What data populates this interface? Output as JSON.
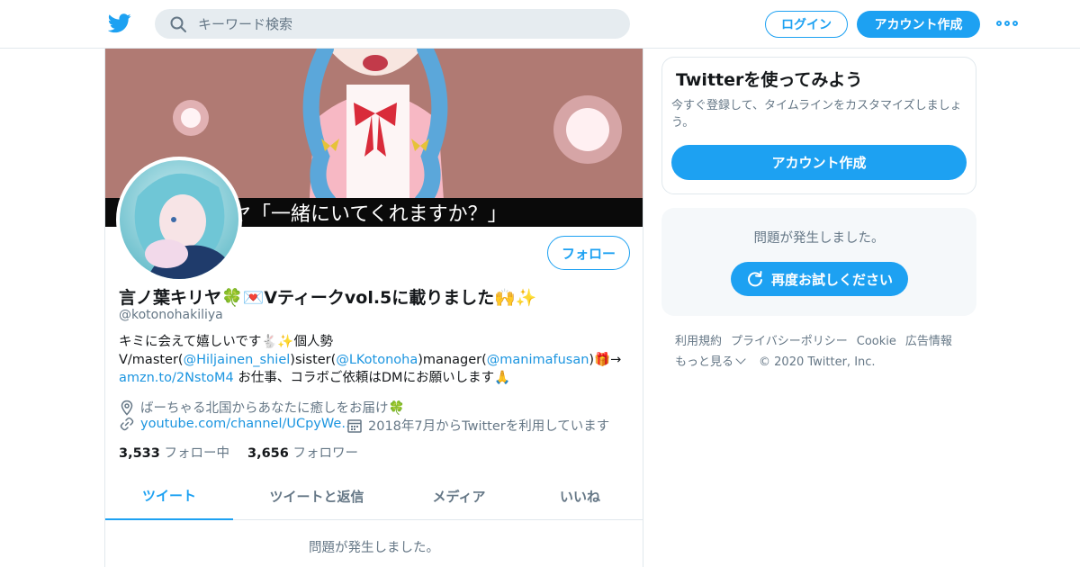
{
  "colors": {
    "brand": "#1da1f2",
    "link": "#1b95e0",
    "muted": "#657786",
    "text": "#14171a",
    "panel": "#f5f8fa"
  },
  "topbar": {
    "search_placeholder": "キーワード検索",
    "login_label": "ログイン",
    "signup_label": "アカウント作成"
  },
  "profile": {
    "banner_caption": "ヤ「一緒にいてくれますか？」",
    "follow_label": "フォロー",
    "display_name": "言ノ葉キリヤ🍀💌Vティークvol.5に載りました🙌✨",
    "handle": "@kotonohakiliya",
    "bio": {
      "line1": "キミに会えて嬉しいです🐇✨個人勢",
      "l2_a": "V/master(",
      "l2_m1": "@Hiljainen_shiel",
      "l2_b": ")sister(",
      "l2_m2": "@LKotonoha",
      "l2_c": ")manager(",
      "l2_m3": "@manimafusan",
      "l2_d": ")🎁→",
      "l3_link": "amzn.to/2NstoM4",
      "l3_rest": " お仕事、コラボご依頼はDMにお願いします🙏"
    },
    "location": "ばーちゃる北国からあなたに癒しをお届け🍀",
    "url": "youtube.com/channel/UCpyWe…",
    "joined": "2018年7月からTwitterを利用しています",
    "following_count": "3,533",
    "following_label": "フォロー中",
    "followers_count": "3,656",
    "followers_label": "フォロワー",
    "tabs": [
      "ツイート",
      "ツイートと返信",
      "メディア",
      "いいね"
    ],
    "error_text": "問題が発生しました。"
  },
  "sidebar": {
    "card_title": "Twitterを使ってみよう",
    "card_text": "今すぐ登録して、タイムラインをカスタマイズしましょう。",
    "card_button": "アカウント作成",
    "error_text": "問題が発生しました。",
    "retry_label": "再度お試しください",
    "footer_links": [
      "利用規約",
      "プライバシーポリシー",
      "Cookie",
      "広告情報"
    ],
    "footer_more": "もっと見る",
    "copyright": "© 2020 Twitter, Inc."
  }
}
